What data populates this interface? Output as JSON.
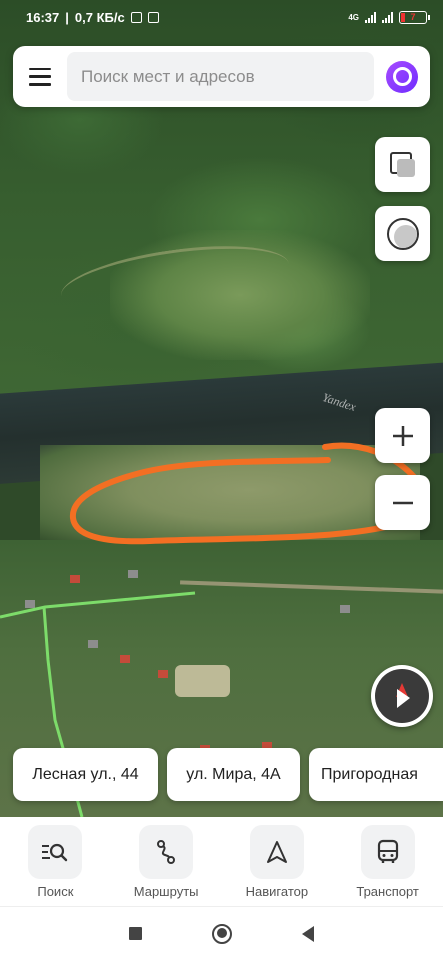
{
  "status_bar": {
    "time": "16:37",
    "speed": "0,7 КБ/с",
    "network": "4G",
    "battery": "7"
  },
  "search": {
    "placeholder": "Поиск мест и адресов"
  },
  "map": {
    "watermark": "Yandex",
    "annotation_color": "#f36f23"
  },
  "chips": [
    {
      "label": "Лесная ул., 44"
    },
    {
      "label": "ул. Мира, 4А"
    },
    {
      "label": "Пригородная"
    }
  ],
  "bottom_nav": [
    {
      "label": "Поиск",
      "icon": "search-list-icon"
    },
    {
      "label": "Маршруты",
      "icon": "route-icon"
    },
    {
      "label": "Навигатор",
      "icon": "navigator-arrow-icon"
    },
    {
      "label": "Транспорт",
      "icon": "bus-icon"
    }
  ],
  "colors": {
    "alice_accent": "#8b3dff",
    "compass_red": "#e53935"
  }
}
